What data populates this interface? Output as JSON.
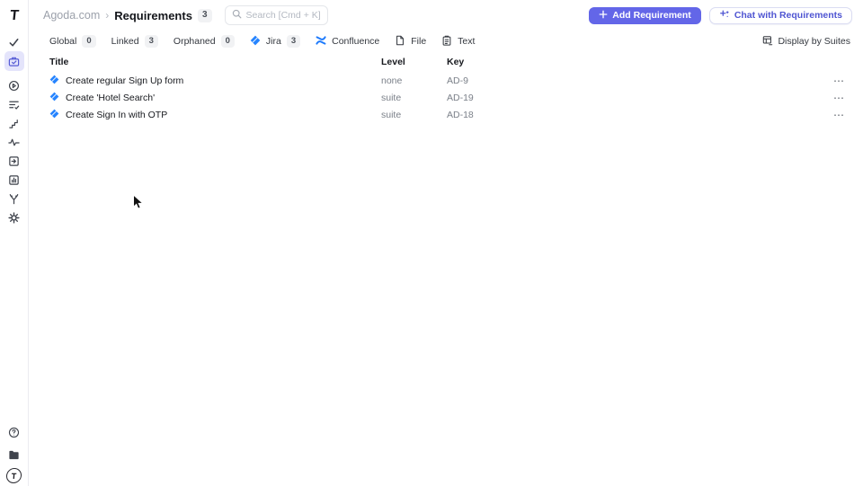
{
  "app": {
    "logo_letter": "T",
    "avatar_letter": "T"
  },
  "sidebar": {
    "icons": [
      "check-icon",
      "requirements-icon",
      "play-circle-icon",
      "checklist-icon",
      "steps-icon",
      "activity-icon",
      "import-icon",
      "reports-icon",
      "branch-icon",
      "settings-gear-icon"
    ],
    "footer_icons": [
      "help-icon",
      "folder-icon",
      "user-avatar"
    ]
  },
  "header": {
    "breadcrumb": {
      "project": "Agoda.com",
      "separator": "›",
      "page": "Requirements",
      "count": "3"
    },
    "search_placeholder": "Search [Cmd + K]",
    "add_button_label": "Add Requirement",
    "chat_button_label": "Chat with Requirements"
  },
  "filters": {
    "tabs": [
      {
        "label": "Global",
        "count": "0"
      },
      {
        "label": "Linked",
        "count": "3"
      },
      {
        "label": "Orphaned",
        "count": "0"
      },
      {
        "label": "Jira",
        "count": "3",
        "icon": "jira-icon"
      },
      {
        "label": "Confluence",
        "icon": "confluence-icon"
      },
      {
        "label": "File",
        "icon": "file-icon"
      },
      {
        "label": "Text",
        "icon": "clipboard-icon"
      }
    ],
    "display_toggle_label": "Display by Suites"
  },
  "table": {
    "columns": [
      "Title",
      "Level",
      "Key"
    ],
    "rows": [
      {
        "title": "Create regular Sign Up form",
        "level": "none",
        "key": "AD-9"
      },
      {
        "title": "Create 'Hotel Search'",
        "level": "suite",
        "key": "AD-19"
      },
      {
        "title": "Create Sign In with OTP",
        "level": "suite",
        "key": "AD-18"
      }
    ],
    "row_menu_glyph": "⋯"
  },
  "colors": {
    "accent": "#6366e8",
    "active_item_bg": "#e4e4fb",
    "jira_blue": "#2684FF",
    "confluence_blue": "#1d7afc",
    "badge_bg": "#f1f2f4"
  }
}
